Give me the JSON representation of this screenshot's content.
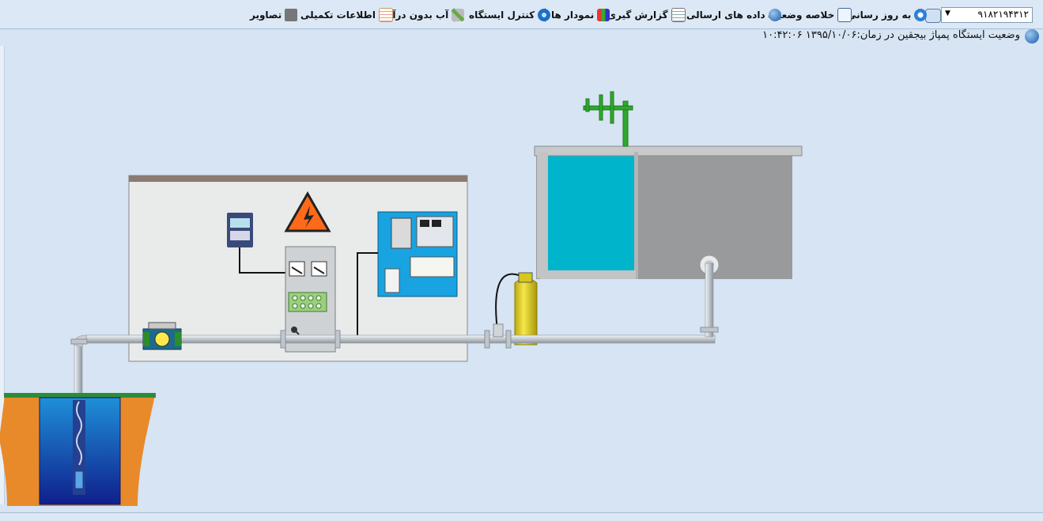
{
  "toolbar": {
    "station_id": "۹۱۸۲۱۹۴۳۱۲",
    "refresh": "به روز رسانی",
    "summary": "خلاصه وضعیت",
    "sent_data": "داده های ارسالی",
    "reporting": "گزارش گیری",
    "charts": "نمودار ها",
    "station_control": "کنترل ایستگاه",
    "non_revenue_water": "آب بدون درآمد",
    "extra_info": "اطلاعات تکمیلی",
    "images": "تصاویر"
  },
  "status": {
    "text": "وضعیت ایستگاه پمپاژ بیجقین در زمان:۱۳۹۵/۱۰/۰۶   ۱۰:۴۲:۰۶"
  },
  "colors": {
    "background": "#d6e4f3",
    "water": "#00b4cc",
    "well_water": "#1e4fb0",
    "soil": "#e88a2a",
    "antenna": "#2eaa2e",
    "cylinder": "#e6d52a",
    "warning": "#ff6a1a"
  }
}
